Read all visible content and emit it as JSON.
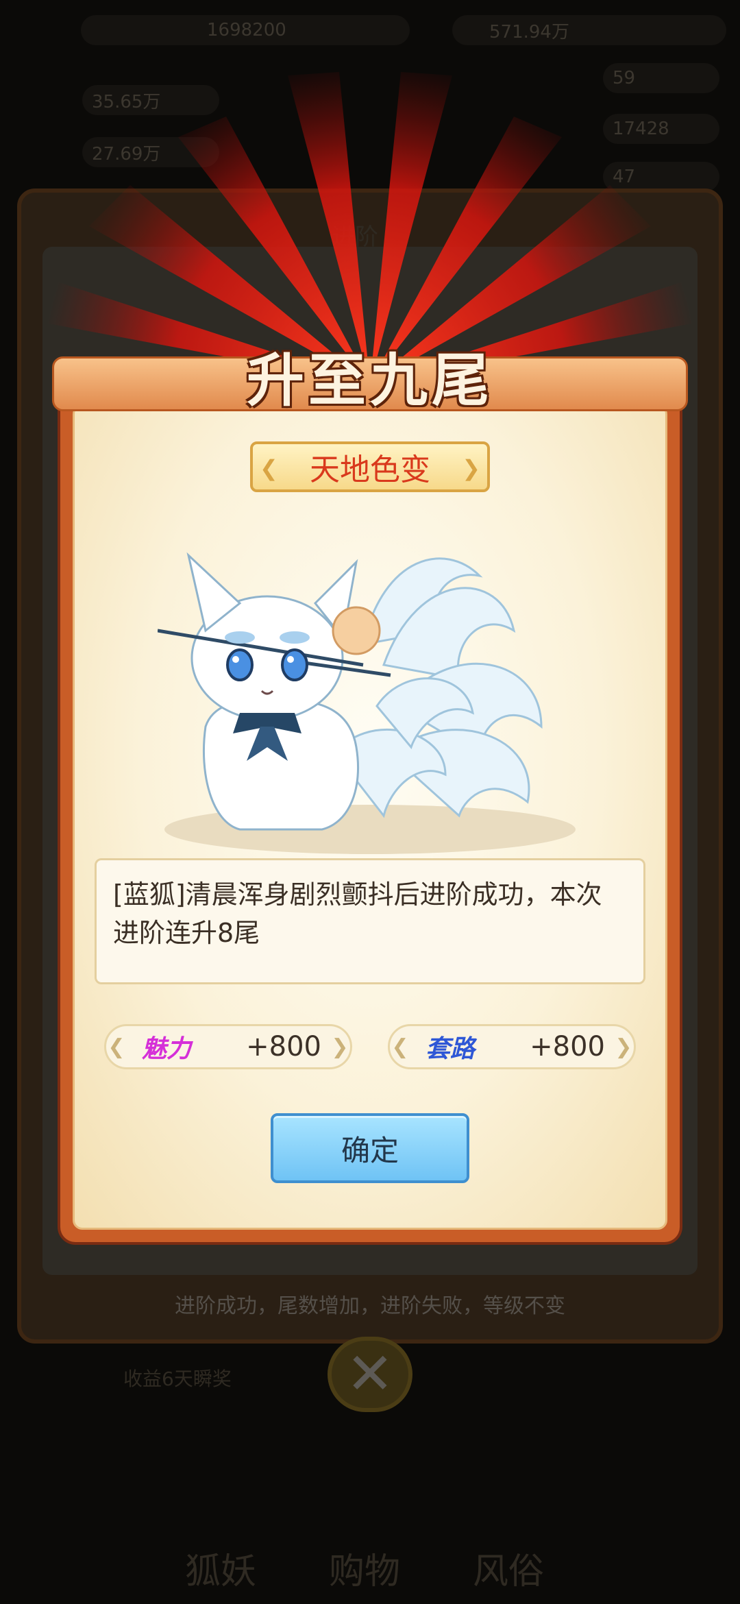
{
  "background": {
    "top_value": "1698200",
    "resource_value": "571.94万",
    "stat_1": "35.65万",
    "stat_2": "27.69万",
    "side_1": "59",
    "side_2": "17428",
    "side_3": "47",
    "panel_title": "进阶",
    "hint": "进阶成功，尾数增加，进阶失败，等级不变",
    "task_text": "收益6天瞬奖",
    "bottom_tabs": [
      "狐妖",
      "购物",
      "风俗"
    ]
  },
  "modal": {
    "title": "升至九尾",
    "banner": "天地色变",
    "description": "[蓝狐]清晨浑身剧烈颤抖后进阶成功，本次进阶连升8尾",
    "stats": [
      {
        "label": "魅力",
        "value": "+800",
        "color": "#d52fd8"
      },
      {
        "label": "套路",
        "value": "+800",
        "color": "#2e57d6"
      }
    ],
    "confirm_label": "确定"
  },
  "colors": {
    "accent_orange": "#c95d27",
    "ray_red": "#e01b12",
    "confirm_blue": "#6fc3f5"
  }
}
